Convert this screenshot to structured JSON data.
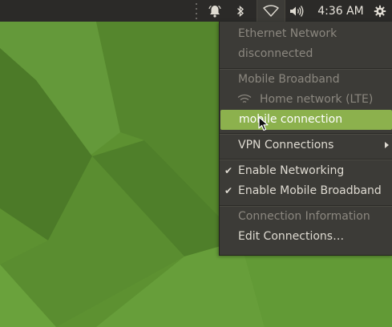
{
  "top_panel": {
    "clock": "4:36 AM",
    "icons": [
      "notification-bell-icon",
      "bluetooth-icon",
      "wifi-icon",
      "volume-icon",
      "gear-icon"
    ],
    "background": "#2b2a28"
  },
  "network_menu": {
    "ethernet_header": "Ethernet Network",
    "ethernet_status": "disconnected",
    "mobile_header": "Mobile Broadband",
    "mobile_network": "Home network (LTE)",
    "mobile_connection": "mobile connection",
    "vpn": "VPN Connections",
    "enable_networking": "Enable Networking",
    "enable_mobile": "Enable Mobile Broadband",
    "connection_info": "Connection Information",
    "edit_connections": "Edit Connections…",
    "highlight_color": "#8cb14d",
    "menu_background": "#3c3b37"
  },
  "checks": {
    "enable_networking": "✔",
    "enable_mobile": "✔"
  }
}
